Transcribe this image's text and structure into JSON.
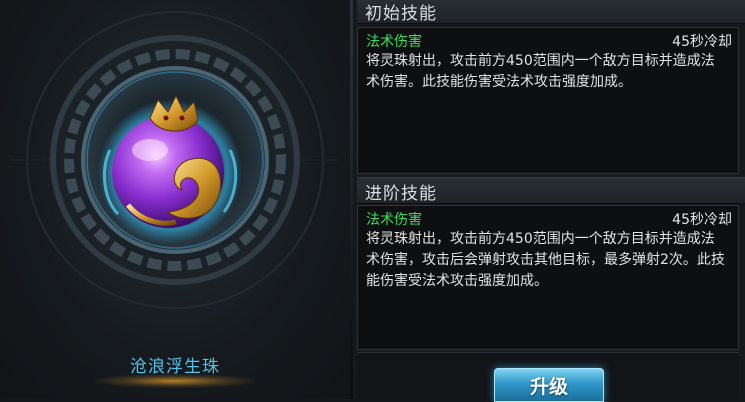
{
  "item": {
    "name": "沧浪浮生珠"
  },
  "initial_skill": {
    "header": "初始技能",
    "name": "法术伤害",
    "cooldown": "45秒冷却",
    "description": "将灵珠射出，攻击前方450范围内一个敌方目标并造成法术伤害。此技能伤害受法术攻击强度加成。"
  },
  "advanced_skill": {
    "header": "进阶技能",
    "name": "法术伤害",
    "cooldown": "45秒冷却",
    "description": "将灵珠射出，攻击前方450范围内一个敌方目标并造成法术伤害，攻击后会弹射攻击其他目标，最多弹射2次。此技能伤害受法术攻击强度加成。"
  },
  "actions": {
    "upgrade_label": "升级"
  },
  "colors": {
    "skill_name": "#38e05a",
    "item_name": "#4fc3e8",
    "orb_purple": "#a24be0",
    "button_blue": "#2f97c9"
  }
}
